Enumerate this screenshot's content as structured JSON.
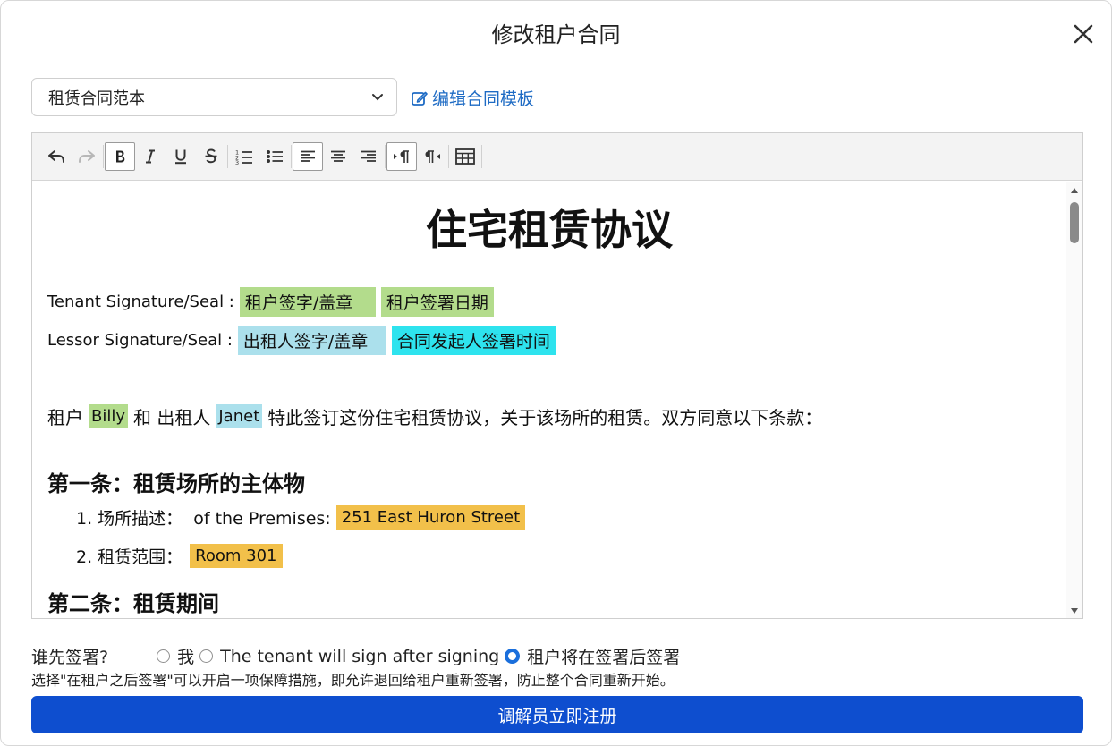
{
  "dialog": {
    "title": "修改租户合同",
    "close_icon": "close-icon"
  },
  "template_select": {
    "value": "租赁合同范本",
    "edit_label": "编辑合同模板"
  },
  "toolbar": {
    "icons": [
      "undo-icon",
      "redo-icon",
      "bold-icon",
      "italic-icon",
      "underline-icon",
      "strikethrough-icon",
      "ordered-list-icon",
      "bullet-list-icon",
      "align-left-icon",
      "align-center-icon",
      "align-right-icon",
      "ltr-icon",
      "rtl-icon",
      "table-icon"
    ]
  },
  "document": {
    "title": "住宅租赁协议",
    "tenant_sig_label": "Tenant Signature/Seal :",
    "tenant_sig_field": "租户签字/盖章",
    "tenant_date_field": "租户签署日期",
    "lessor_sig_label": "Lessor Signature/Seal :",
    "lessor_sig_field": "出租人签字/盖章",
    "lessor_date_field": "合同发起人签署时间",
    "intro_1": "租户",
    "tenant_name": "Billy",
    "intro_2": "和 出租人",
    "lessor_name": "Janet",
    "intro_3": "特此签订这份住宅租赁协议，关于该场所的租赁。双方同意以下条款：",
    "section1_title": "第一条：租赁场所的主体物",
    "item1_label": "1. 场所描述：  of the Premises:",
    "item1_value": "251 East Huron Street",
    "item2_label": "2. 租赁范围：",
    "item2_value": "Room 301",
    "section2_title": "第二条：租赁期间"
  },
  "signing": {
    "question": "谁先签署?",
    "options": [
      "我",
      "The tenant will sign after signing",
      "租户将在签署后签署"
    ],
    "selected_index": 2,
    "hint": "选择\"在租户之后签署\"可以开启一项保障措施，即允许退回给租户重新签署，防止整个合同重新开始。",
    "submit_label": "调解员立即注册"
  },
  "colors": {
    "accent": "#0e4ecf",
    "link": "#1e6bc4",
    "highlight_green": "#b3dc8c",
    "highlight_blue": "#abe0ec",
    "highlight_cyan": "#2ee3ee",
    "highlight_orange": "#f2c04a"
  }
}
